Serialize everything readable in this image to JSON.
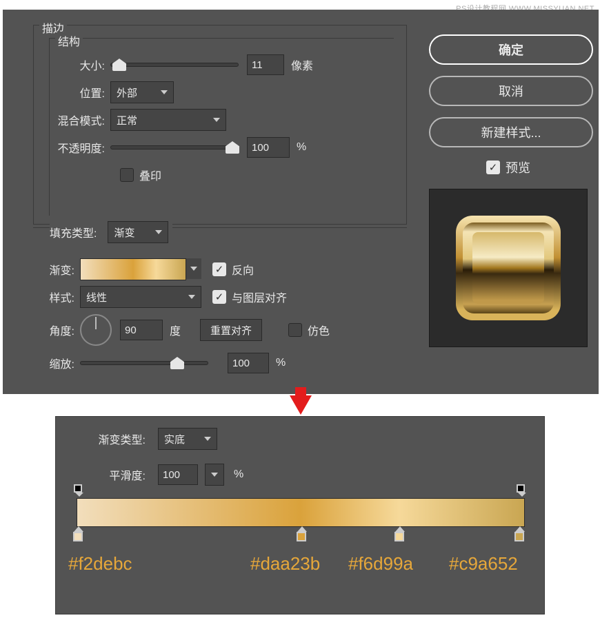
{
  "watermark": "PS设计教程网  WWW.MISSYUAN.NET",
  "stroke": {
    "title": "描边",
    "structure": "结构",
    "size_label": "大小:",
    "size_value": "11",
    "size_unit": "像素",
    "position_label": "位置:",
    "position_value": "外部",
    "blend_label": "混合模式:",
    "blend_value": "正常",
    "opacity_label": "不透明度:",
    "opacity_value": "100",
    "opacity_unit": "%",
    "overprint_label": "叠印"
  },
  "fill": {
    "type_label": "填充类型:",
    "type_value": "渐变",
    "gradient_label": "渐变:",
    "reverse_label": "反向",
    "style_label": "样式:",
    "style_value": "线性",
    "align_label": "与图层对齐",
    "angle_label": "角度:",
    "angle_value": "90",
    "angle_unit": "度",
    "reset_align": "重置对齐",
    "dither_label": "仿色",
    "scale_label": "缩放:",
    "scale_value": "100",
    "scale_unit": "%"
  },
  "buttons": {
    "ok": "确定",
    "cancel": "取消",
    "new_style": "新建样式...",
    "preview": "预览"
  },
  "gradient_editor": {
    "type_label": "渐变类型:",
    "type_value": "实底",
    "smoothness_label": "平滑度:",
    "smoothness_value": "100",
    "smoothness_unit": "%",
    "stops": [
      {
        "hex": "#f2debc",
        "pos": 0
      },
      {
        "hex": "#daa23b",
        "pos": 50
      },
      {
        "hex": "#f6d99a",
        "pos": 72
      },
      {
        "hex": "#c9a652",
        "pos": 100
      }
    ]
  }
}
